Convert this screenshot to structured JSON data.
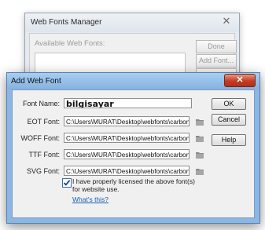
{
  "manager": {
    "title": "Web Fonts Manager",
    "available_label": "Available Web Fonts:",
    "done_label": "Done",
    "add_font_label": "Add Font...",
    "close_glyph": "✕"
  },
  "dialog": {
    "title": "Add Web Font",
    "close_glyph": "✕",
    "font_name_label": "Font Name:",
    "font_name_value": "bilgisayar",
    "eot_label": "EOT Font:",
    "eot_value": "C:\\Users\\MURAT\\Desktop\\webfonts\\carbontype\\ca",
    "woff_label": "WOFF Font:",
    "woff_value": "C:\\Users\\MURAT\\Desktop\\webfonts\\carbontype\\ca",
    "ttf_label": "TTF Font:",
    "ttf_value": "C:\\Users\\MURAT\\Desktop\\webfonts\\carbontype\\ca",
    "svg_label": "SVG Font:",
    "svg_value": "C:\\Users\\MURAT\\Desktop\\webfonts\\carbontype\\ca",
    "ok_label": "OK",
    "cancel_label": "Cancel",
    "help_label": "Help",
    "license_label": "I have properly licensed the above font(s) for website use.",
    "license_checked": true,
    "whats_this": "What's this?"
  },
  "colors": {
    "title_blue": "#8cb6e3",
    "close_red": "#c43b22",
    "link_blue": "#1a5fb4"
  }
}
